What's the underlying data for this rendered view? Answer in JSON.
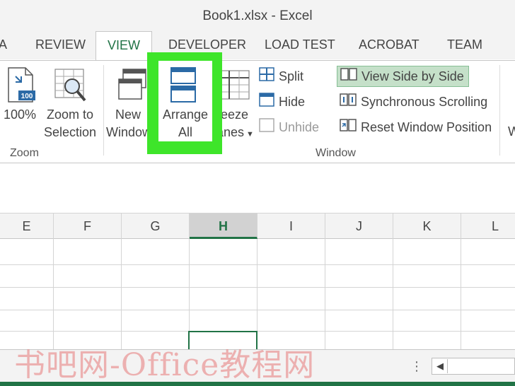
{
  "title": "Book1.xlsx - Excel",
  "tabs": [
    {
      "label": "A"
    },
    {
      "label": "REVIEW"
    },
    {
      "label": "VIEW"
    },
    {
      "label": "DEVELOPER"
    },
    {
      "label": "LOAD TEST"
    },
    {
      "label": "ACROBAT"
    },
    {
      "label": "TEAM"
    }
  ],
  "ribbon": {
    "zoom_group": {
      "label": "Zoom",
      "zoom100": {
        "line1": "100%"
      },
      "zoom_to_selection": {
        "line1": "Zoom to",
        "line2": "Selection"
      }
    },
    "window_group": {
      "label": "Window",
      "new_window": {
        "line1": "New",
        "line2": "Window"
      },
      "arrange_all": {
        "line1": "Arrange",
        "line2": "All"
      },
      "freeze_panes": {
        "line1": "reeze",
        "line2": "anes"
      },
      "split": "Split",
      "hide": "Hide",
      "unhide": "Unhide",
      "view_side_by_side": "View Side by Side",
      "synchronous_scrolling": "Synchronous Scrolling",
      "reset_window_position": "Reset Window Position",
      "partial": "W"
    }
  },
  "columns": [
    "E",
    "F",
    "G",
    "H",
    "I",
    "J",
    "K",
    "L"
  ],
  "watermark": "书吧网-Office教程网",
  "sheet_options": "⋮",
  "scroll_left": "◀",
  "colors": {
    "accent": "#217346",
    "highlight": "#3ee52a",
    "toggle_bg": "#c5e0c9"
  }
}
